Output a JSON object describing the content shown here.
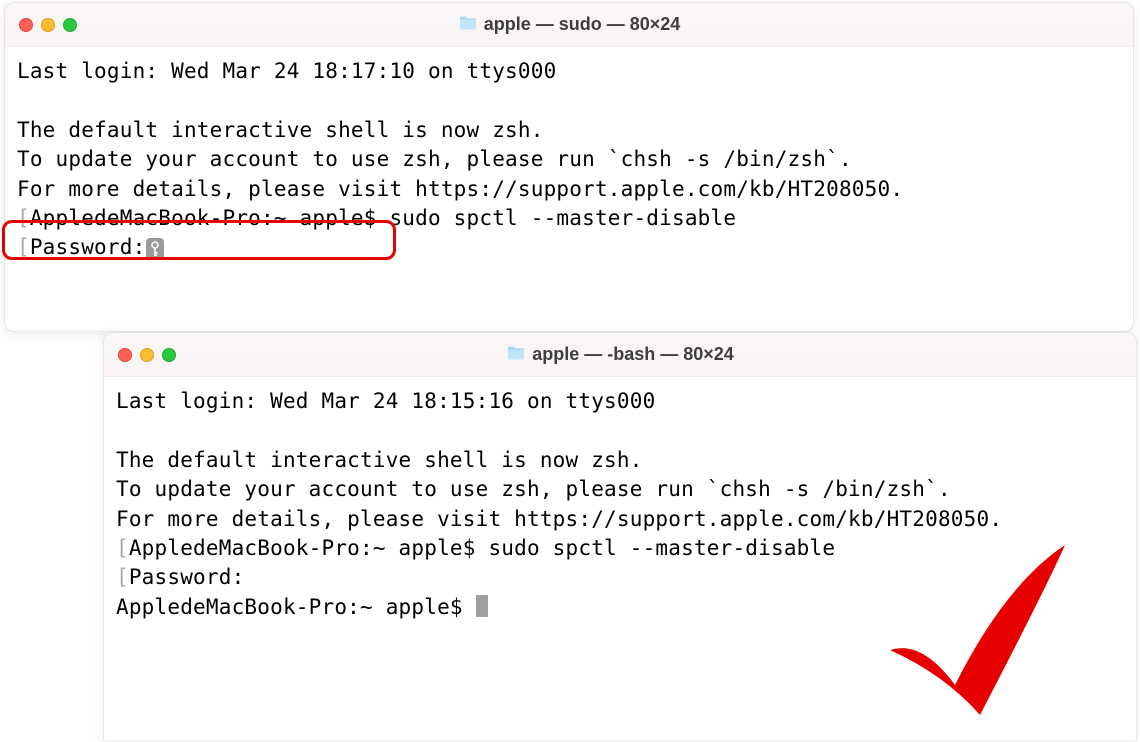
{
  "window1": {
    "title": "apple — sudo — 80×24",
    "folder_icon": "folder-icon",
    "lines": {
      "l1": "Last login: Wed Mar 24 18:17:10 on ttys000",
      "l2": "",
      "l3": "The default interactive shell is now zsh.",
      "l4": "To update your account to use zsh, please run `chsh -s /bin/zsh`.",
      "l5": "For more details, please visit https://support.apple.com/kb/HT208050.",
      "l6": "AppledeMacBook-Pro:~ apple$ sudo spctl --master-disable",
      "l7": "Password:"
    }
  },
  "window2": {
    "title": "apple — -bash — 80×24",
    "folder_icon": "folder-icon",
    "lines": {
      "l1": "Last login: Wed Mar 24 18:15:16 on ttys000",
      "l2": "",
      "l3": "The default interactive shell is now zsh.",
      "l4": "To update your account to use zsh, please run `chsh -s /bin/zsh`.",
      "l5": "For more details, please visit https://support.apple.com/kb/HT208050.",
      "l6": "AppledeMacBook-Pro:~ apple$ sudo spctl --master-disable",
      "l7": "Password:",
      "l8": "AppledeMacBook-Pro:~ apple$ "
    }
  }
}
